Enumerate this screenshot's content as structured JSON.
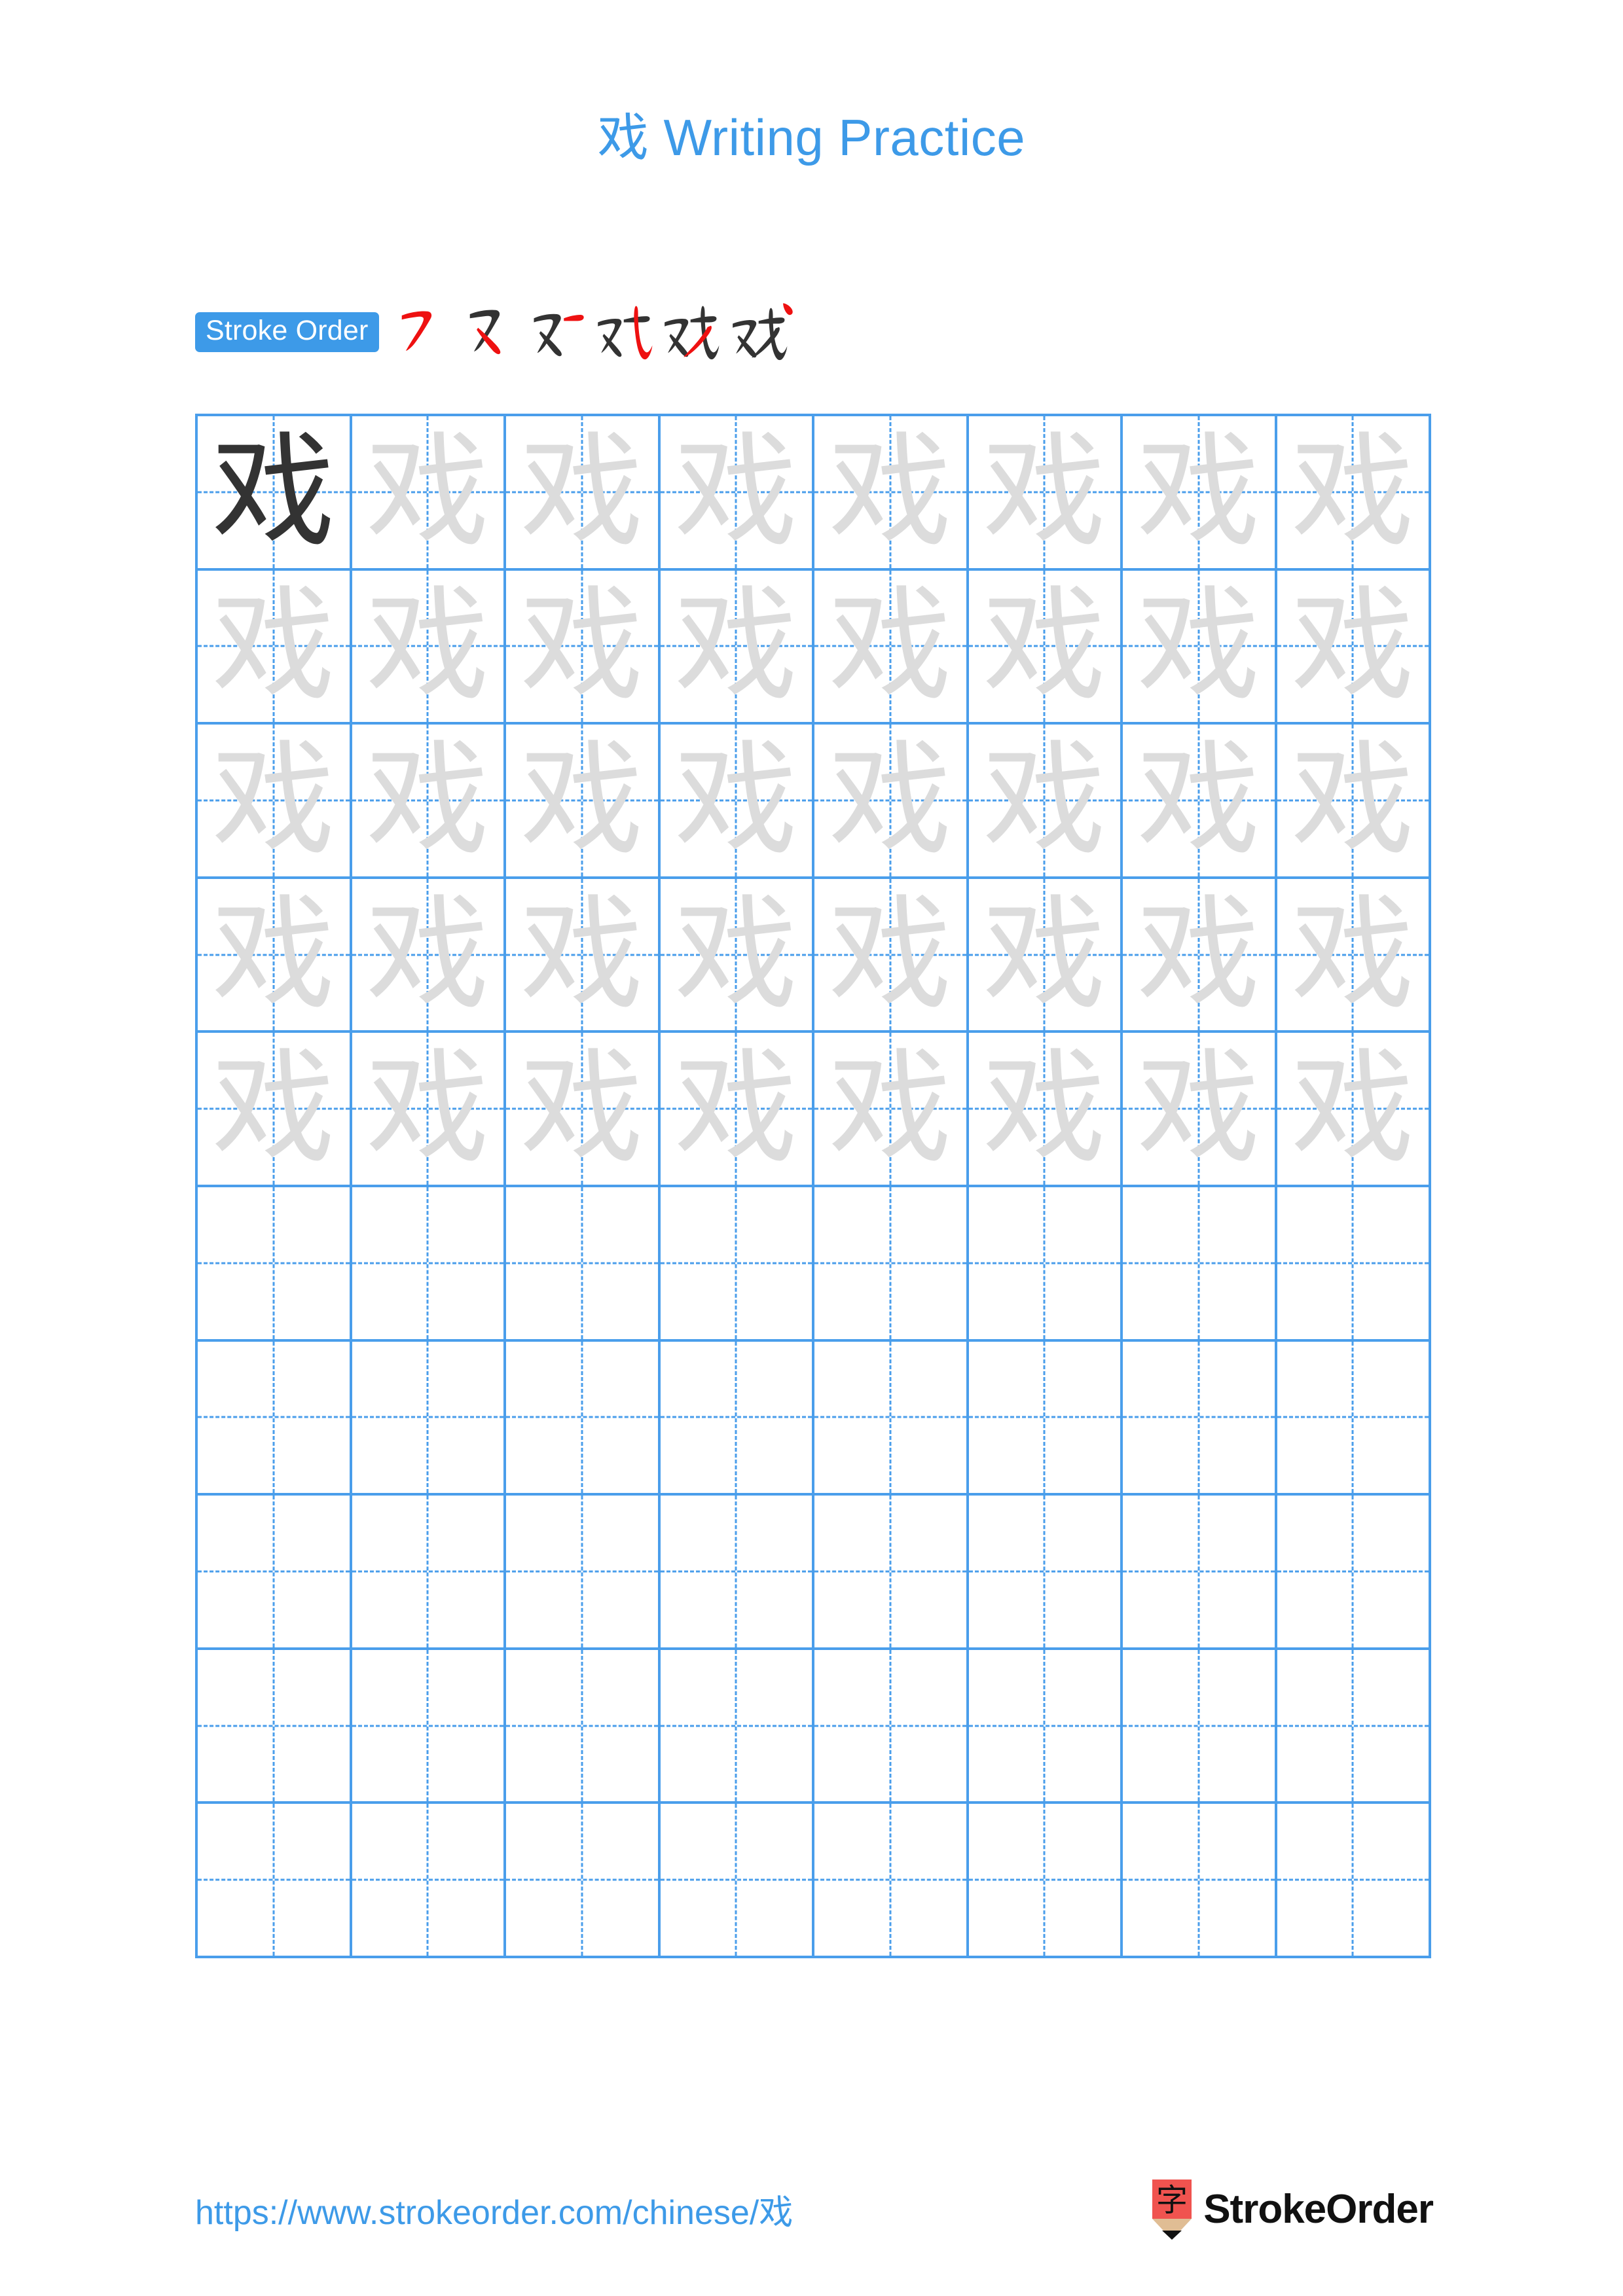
{
  "page": {
    "background": "#ffffff",
    "accent_blue": "#3d9ae8",
    "grid_blue": "#4a9eeb",
    "trace_gray": "#dcdcdc",
    "ink_dark": "#333333",
    "stroke_highlight_red": "#ee1111",
    "logo_red": "#f0534f",
    "logo_wood": "#e0bd94"
  },
  "header": {
    "title": "戏 Writing Practice",
    "character": "戏"
  },
  "stroke_order": {
    "badge_label": "Stroke Order",
    "total_strokes": 6,
    "steps": [
      {
        "index": 1,
        "glyph": "㇇",
        "new_stroke": "横撇",
        "cumulative": "㇇"
      },
      {
        "index": 2,
        "glyph": "又",
        "new_stroke": "捺",
        "cumulative": "又"
      },
      {
        "index": 3,
        "glyph": "又一",
        "new_stroke": "横",
        "cumulative": "又+横"
      },
      {
        "index": 4,
        "glyph": "戏",
        "new_stroke": "斜钩",
        "cumulative": "又+横+斜钩"
      },
      {
        "index": 5,
        "glyph": "戏",
        "new_stroke": "撇",
        "cumulative": "又+横+斜钩+撇"
      },
      {
        "index": 6,
        "glyph": "戏",
        "new_stroke": "点",
        "cumulative": "戏"
      }
    ]
  },
  "practice_grid": {
    "columns": 8,
    "rows": 10,
    "filled_rows": 5,
    "character": "戏",
    "cells": [
      [
        "dark",
        "trace",
        "trace",
        "trace",
        "trace",
        "trace",
        "trace",
        "trace"
      ],
      [
        "trace",
        "trace",
        "trace",
        "trace",
        "trace",
        "trace",
        "trace",
        "trace"
      ],
      [
        "trace",
        "trace",
        "trace",
        "trace",
        "trace",
        "trace",
        "trace",
        "trace"
      ],
      [
        "trace",
        "trace",
        "trace",
        "trace",
        "trace",
        "trace",
        "trace",
        "trace"
      ],
      [
        "trace",
        "trace",
        "trace",
        "trace",
        "trace",
        "trace",
        "trace",
        "trace"
      ],
      [
        "empty",
        "empty",
        "empty",
        "empty",
        "empty",
        "empty",
        "empty",
        "empty"
      ],
      [
        "empty",
        "empty",
        "empty",
        "empty",
        "empty",
        "empty",
        "empty",
        "empty"
      ],
      [
        "empty",
        "empty",
        "empty",
        "empty",
        "empty",
        "empty",
        "empty",
        "empty"
      ],
      [
        "empty",
        "empty",
        "empty",
        "empty",
        "empty",
        "empty",
        "empty",
        "empty"
      ],
      [
        "empty",
        "empty",
        "empty",
        "empty",
        "empty",
        "empty",
        "empty",
        "empty"
      ]
    ]
  },
  "footer": {
    "url": "https://www.strokeorder.com/chinese/戏",
    "brand_name": "StrokeOrder",
    "brand_mark_character": "字"
  }
}
